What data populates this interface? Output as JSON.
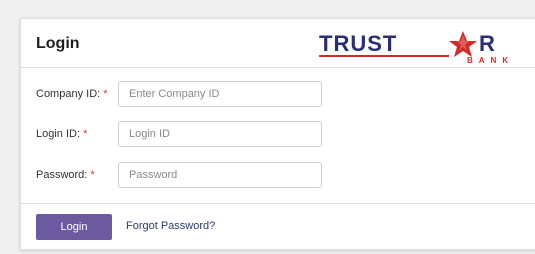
{
  "form": {
    "title": "Login",
    "logo": {
      "text_main": "TRUST",
      "text_end": "R",
      "text_sub": "BANK",
      "icon": "star-icon",
      "brand_color": "#2a2f74",
      "accent_color": "#d62828"
    },
    "fields": [
      {
        "label": "Company ID:",
        "required_mark": "*",
        "placeholder": "Enter Company ID",
        "value": ""
      },
      {
        "label": "Login ID:",
        "required_mark": "*",
        "placeholder": "Login ID",
        "value": ""
      },
      {
        "label": "Password:",
        "required_mark": "*",
        "placeholder": "Password",
        "value": ""
      }
    ],
    "submit_label": "Login",
    "forgot_link": "Forgot Password?"
  },
  "colors": {
    "button": "#6b5aa0",
    "required": "#d43a3a",
    "link": "#2a3a6b"
  }
}
